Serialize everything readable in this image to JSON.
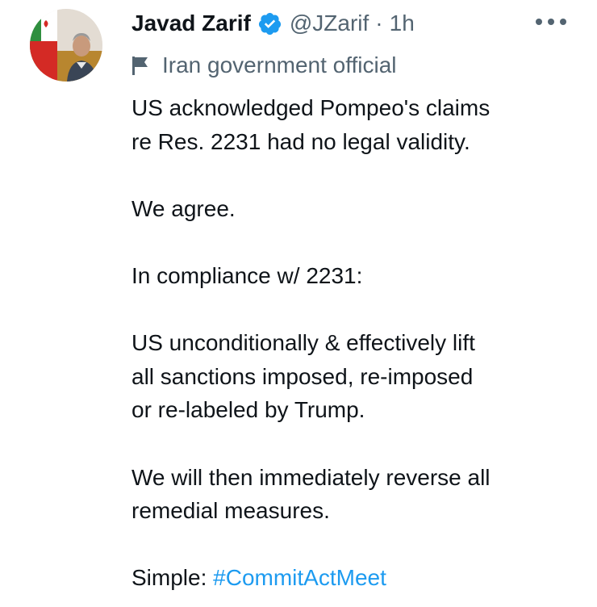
{
  "tweet": {
    "author": {
      "name": "Javad Zarif",
      "handle": "@JZarif",
      "verified": true,
      "avatar_icon": "profile-photo"
    },
    "separator": "·",
    "time": "1h",
    "label": "Iran government official",
    "label_icon": "flag-icon",
    "more_icon": "more-horizontal-icon",
    "body": {
      "p1_line1": "US acknowledged Pompeo's claims",
      "p1_line2": "re Res. 2231 had no legal validity.",
      "p2": "We agree.",
      "p3": "In compliance w/ 2231:",
      "p4_line1": "US unconditionally & effectively lift",
      "p4_line2": "all sanctions imposed, re-imposed",
      "p4_line3": "or re-labeled by Trump.",
      "p5_line1": "We will then immediately reverse all",
      "p5_line2": "remedial measures.",
      "p6_prefix": "Simple: ",
      "hashtag": "#CommitActMeet"
    }
  },
  "colors": {
    "text_primary": "#0f1419",
    "text_secondary": "#536471",
    "accent": "#1d9bf0"
  }
}
